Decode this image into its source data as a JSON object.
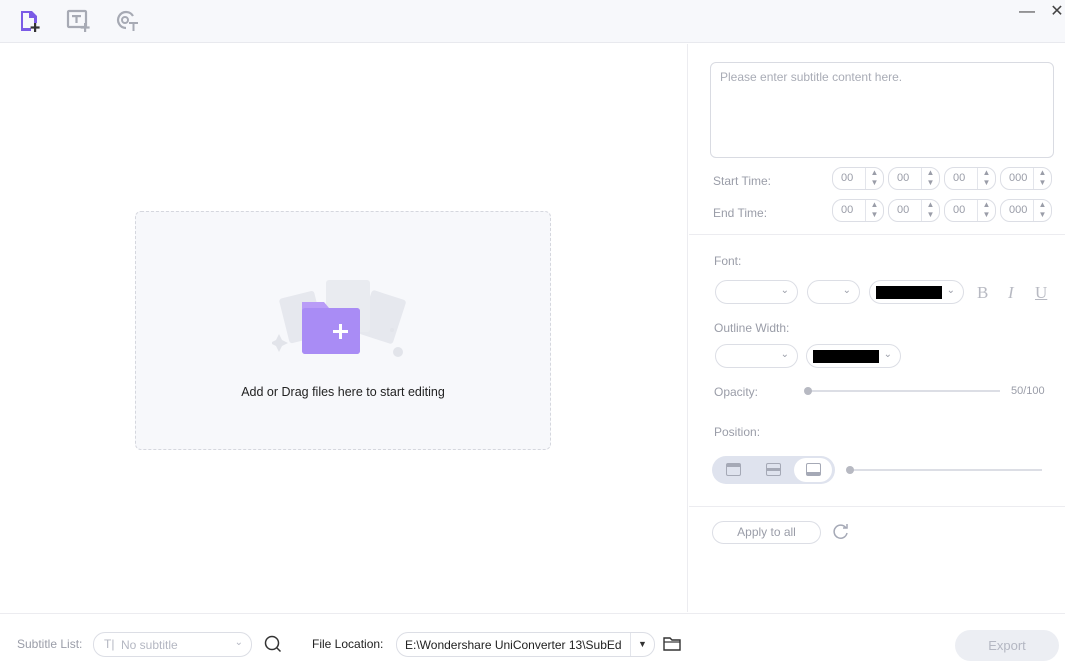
{
  "toolbar": {
    "icons": [
      "add-file-icon",
      "add-subtitle-icon",
      "auto-subtitle-icon"
    ],
    "accent": "#7b5be6"
  },
  "window": {
    "minimize": "—",
    "close": "✕"
  },
  "dropzone": {
    "text": "Add or Drag files here to start editing",
    "accent": "#a98cf5"
  },
  "editor": {
    "subtitle_placeholder": "Please enter subtitle content here.",
    "start_time_label": "Start Time:",
    "end_time_label": "End Time:",
    "start_time": [
      "00",
      "00",
      "00",
      "000"
    ],
    "end_time": [
      "00",
      "00",
      "00",
      "000"
    ],
    "font_label": "Font:",
    "font_color": "#000000",
    "bold": "B",
    "italic": "I",
    "underline": "U",
    "outline_label": "Outline Width:",
    "outline_color": "#000000",
    "opacity_label": "Opacity:",
    "opacity_value": "50/100",
    "position_label": "Position:",
    "position_options": [
      "top",
      "middle",
      "bottom"
    ],
    "position_selected": "bottom",
    "apply_label": "Apply to all"
  },
  "bottom": {
    "subtitle_list_label": "Subtitle List:",
    "subtitle_select_value": "No subtitle",
    "file_location_label": "File Location:",
    "file_location_value": "E:\\Wondershare UniConverter 13\\SubEd",
    "export_label": "Export"
  }
}
